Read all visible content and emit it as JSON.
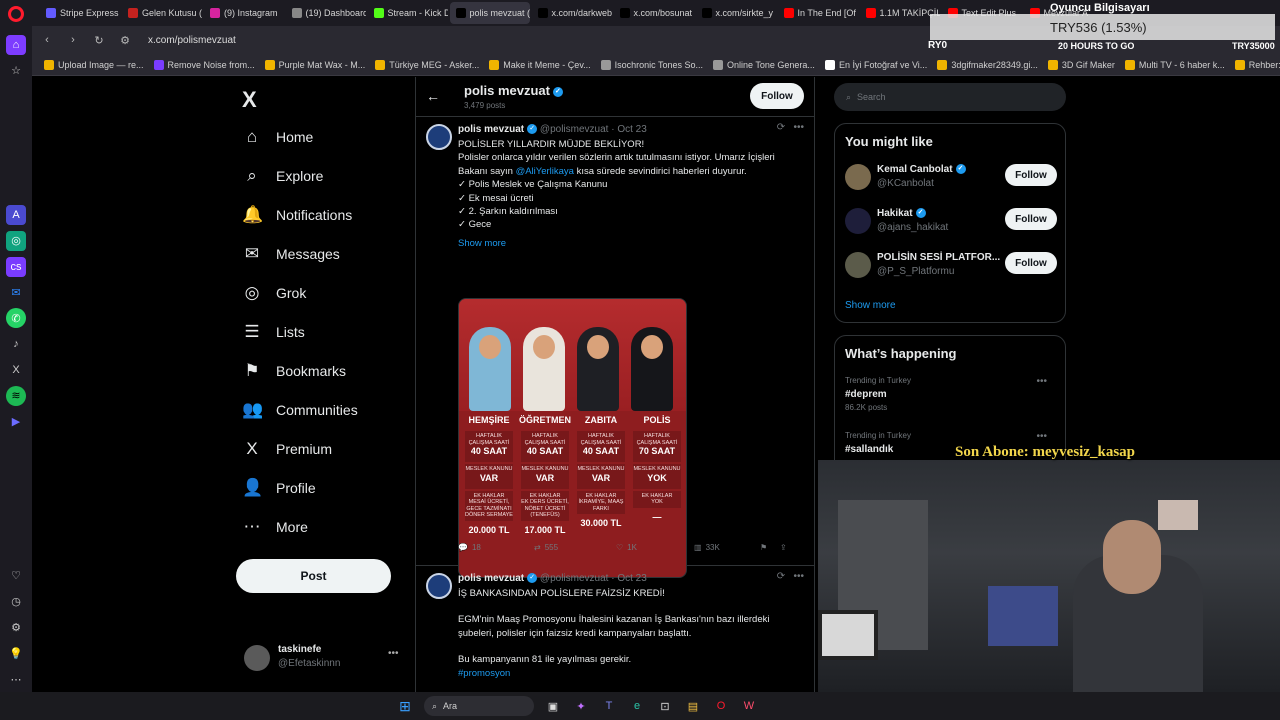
{
  "browser": {
    "tabs": [
      {
        "label": "Stripe Express",
        "color": "#635bff",
        "active": false
      },
      {
        "label": "Gelen Kutusu (",
        "color": "#c5221f",
        "active": false
      },
      {
        "label": "(9) Instagram",
        "color": "#d6249f",
        "active": false
      },
      {
        "label": "(19) Dashboard",
        "color": "#888888",
        "active": false
      },
      {
        "label": "Stream - Kick D",
        "color": "#53fc18",
        "active": false
      },
      {
        "label": "polis mevzuat (@polism",
        "color": "#000000",
        "active": true
      },
      {
        "label": "x.com/darkweb",
        "color": "#000000",
        "active": false
      },
      {
        "label": "x.com/bosunat",
        "color": "#000000",
        "active": false
      },
      {
        "label": "x.com/sirkte_y",
        "color": "#000000",
        "active": false
      },
      {
        "label": "In The End [Of",
        "color": "#ff0000",
        "active": false
      },
      {
        "label": "1.1M TAKİPÇİL",
        "color": "#ff0000",
        "active": false
      },
      {
        "label": "Text Edit Plus",
        "color": "#ff0000",
        "active": false
      },
      {
        "label": "Mevzular A",
        "color": "#ff0000",
        "active": false
      }
    ],
    "url": "x.com/polismevzuat",
    "bookmarks": [
      "Upload Image — re...",
      "Remove Noise from...",
      "Purple Mat Wax - M...",
      "Türkiye MEG - Asker...",
      "Make it Meme - Çev...",
      "Isochronic Tones So...",
      "Online Tone Genera...",
      "En İyi Fotoğraf ve Vi...",
      "3dgifmaker28349.gi...",
      "3D Gif Maker",
      "Multi TV - 6 haber k...",
      "Rehber: Windows 1..."
    ]
  },
  "overlay": {
    "goal_title": "Oyuncu Bilgisayarı",
    "goal_value": "TRY536 (1.53%)",
    "goal_left": "RY0",
    "goal_days": "20 HOURS TO GO",
    "goal_target": "TRY35000",
    "subscriber": "Son Abone: meyvesiz_kasap"
  },
  "nav": {
    "logo": "X",
    "items": [
      {
        "icon": "⌂",
        "label": "Home"
      },
      {
        "icon": "⌕",
        "label": "Explore"
      },
      {
        "icon": "🔔",
        "label": "Notifications"
      },
      {
        "icon": "✉",
        "label": "Messages"
      },
      {
        "icon": "◎",
        "label": "Grok"
      },
      {
        "icon": "☰",
        "label": "Lists"
      },
      {
        "icon": "⚑",
        "label": "Bookmarks"
      },
      {
        "icon": "👥",
        "label": "Communities"
      },
      {
        "icon": "X",
        "label": "Premium"
      },
      {
        "icon": "👤",
        "label": "Profile"
      },
      {
        "icon": "⋯",
        "label": "More"
      }
    ],
    "post_button": "Post",
    "account": {
      "name": "taskinefe",
      "handle": "@Efetaskinnn"
    }
  },
  "profile": {
    "name": "polis mevzuat",
    "posts_count": "3,479 posts",
    "follow_label": "Follow"
  },
  "tweets": [
    {
      "name": "polis mevzuat",
      "handle": "@polismevzuat",
      "date": "· Oct 23",
      "lines": [
        "POLİSLER YILLARDIR MÜJDE BEKLİYOR!",
        "Polisler onlarca yıldır verilen sözlerin artık tutulmasını istiyor. Umarız İçişleri",
        "Bakanı sayın @AliYerlikaya kısa sürede sevindirici haberleri duyurur.",
        "✓ Polis Meslek ve Çalışma Kanunu",
        "✓ Ek mesai ücreti",
        "✓ 2. Şarkın kaldırılması",
        "✓ Gece"
      ],
      "mention": "@AliYerlikaya",
      "show_more": "Show more",
      "card_columns": [
        {
          "title": "HEMŞİRE",
          "hours_label": "HAFTALIK ÇALIŞMA SAATİ",
          "hours": "40 SAAT",
          "law_label": "MESLEK KANUNU",
          "law": "VAR",
          "extra_label": "EK HAKLAR",
          "extra": "MESAİ ÜCRETİ, GECE TAZMİNATI",
          "extra2": "DÖNER SERMAYE",
          "price": "20.000 TL"
        },
        {
          "title": "ÖĞRETMEN",
          "hours_label": "HAFTALIK ÇALIŞMA SAATİ",
          "hours": "40 SAAT",
          "law_label": "MESLEK KANUNU",
          "law": "VAR",
          "extra_label": "EK HAKLAR",
          "extra": "EK DERS ÜCRETİ, NÖBET ÜCRETİ",
          "extra2": "(TENEFÜS)",
          "price": "17.000 TL"
        },
        {
          "title": "ZABITA",
          "hours_label": "HAFTALIK ÇALIŞMA SAATİ",
          "hours": "40 SAAT",
          "law_label": "MESLEK KANUNU",
          "law": "VAR",
          "extra_label": "EK HAKLAR",
          "extra": "İKRAMİYE, MAAŞ FARKI",
          "extra2": "",
          "price": "30.000 TL"
        },
        {
          "title": "POLİS",
          "hours_label": "HAFTALIK ÇALIŞMA SAATİ",
          "hours": "70 SAAT",
          "law_label": "MESLEK KANUNU",
          "law": "YOK",
          "extra_label": "EK HAKLAR",
          "extra": "YOK",
          "extra2": "",
          "price": "—"
        }
      ],
      "replies": "18",
      "reposts": "555",
      "likes": "1K",
      "views": "33K"
    },
    {
      "name": "polis mevzuat",
      "handle": "@polismevzuat",
      "date": "· Oct 23",
      "lines": [
        "İŞ BANKASINDAN POLİSLERE FAİZSİZ KREDİ!",
        "",
        "EGM'nin Maaş Promosyonu İhalesini kazanan İş Bankası'nın bazı illerdeki",
        "şubeleri, polisler için faizsiz kredi kampanyaları başlattı.",
        "",
        "Bu kampanyanın 81 ile yayılması gerekir."
      ],
      "hashtag": "#promosyon"
    }
  ],
  "sidebar": {
    "search_placeholder": "Search",
    "you_might_like": "You might like",
    "suggestions": [
      {
        "name": "Kemal Canbolat",
        "handle": "@KCanbolat",
        "color": "#7a6a4e"
      },
      {
        "name": "Hakikat",
        "handle": "@ajans_hakikat",
        "color": "#1e1e3a"
      },
      {
        "name": "POLİSİN SESİ PLATFOR...",
        "handle": "@P_S_Platformu",
        "color": "#5b5b4a"
      }
    ],
    "follow_label": "Follow",
    "show_more": "Show more",
    "whats_happening": "What’s happening",
    "trends": [
      {
        "context": "Trending in Turkey",
        "name": "#deprem",
        "posts": "86.2K posts"
      },
      {
        "context": "Trending in Turkey",
        "name": "#sallandık",
        "posts": ""
      }
    ]
  },
  "taskbar": {
    "search_label": "Ara"
  }
}
